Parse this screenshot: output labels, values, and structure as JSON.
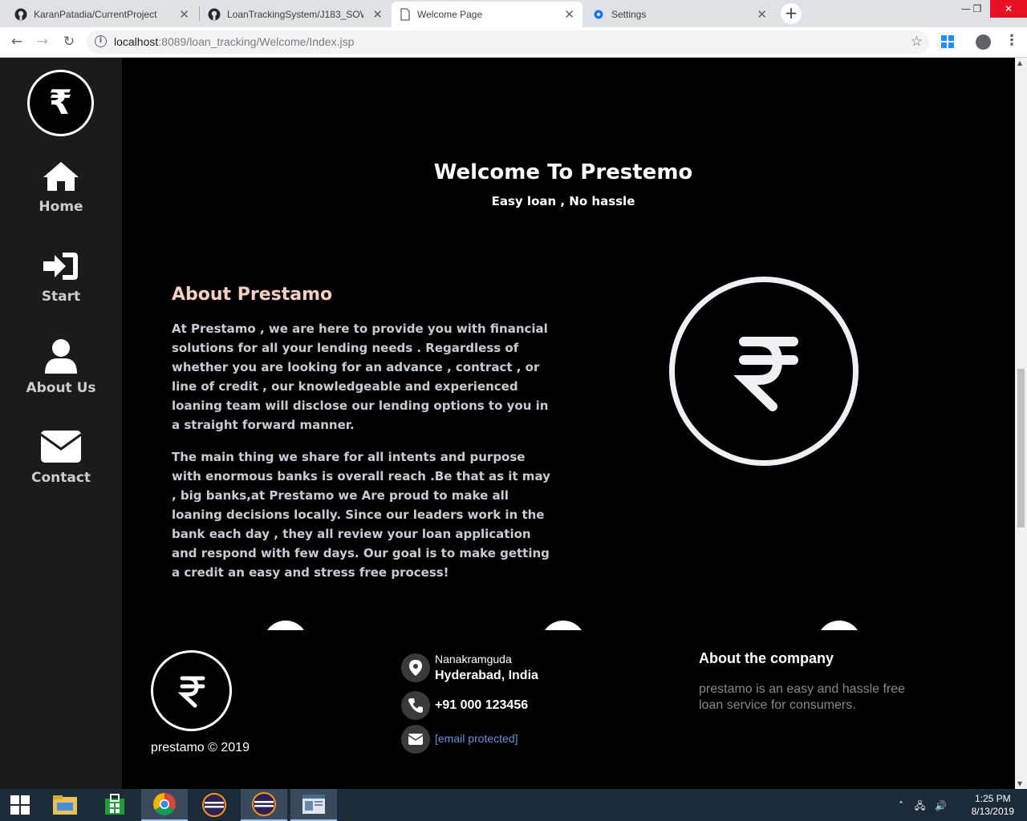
{
  "browser": {
    "tabs": [
      {
        "title": "KaranPatadia/CurrentProject",
        "icon": "github-icon",
        "active": false
      },
      {
        "title": "LoanTrackingSystem/J183_SOW",
        "icon": "github-icon",
        "active": false
      },
      {
        "title": "Welcome Page",
        "icon": "document-icon",
        "active": true
      },
      {
        "title": "Settings",
        "icon": "gear-icon",
        "active": false
      }
    ],
    "new_tab": "+",
    "url_host": "localhost",
    "url_path": ":8089/loan_tracking/Welcome/Index.jsp"
  },
  "sidebar": {
    "logo_symbol": "₹",
    "items": [
      {
        "label": "Home",
        "icon": "home-icon"
      },
      {
        "label": "Start",
        "icon": "sign-in-icon"
      },
      {
        "label": "About Us",
        "icon": "user-icon"
      },
      {
        "label": "Contact",
        "icon": "envelope-icon"
      }
    ]
  },
  "hero": {
    "title": "Welcome To Prestemo",
    "tagline": "Easy loan , No hassle"
  },
  "about": {
    "heading": "About Prestamo",
    "paragraph1": "At Prestamo , we are here to provide you with financial solutions for all your lending needs . Regardless of whether you are looking for an advance , contract , or line of credit , our knowledgeable and experienced loaning team will disclose our lending options to you in a straight forward manner.",
    "paragraph2": "The main thing we share for all intents and purpose with enormous banks is overall reach .Be that as it may , big banks,at Prestamo we Are proud to make all loaning decisions locally. Since our leaders work in the bank each day , they all review your loan application and respond with few days. Our goal is to make getting a credit an easy and stress free process!"
  },
  "footer": {
    "copyright": "prestamo © 2019",
    "address_line1": "Nanakramguda",
    "address_line2": "Hyderabad, India",
    "phone": "+91 000 123456",
    "email": "[email protected]",
    "about_heading": "About the company",
    "about_text": "prestamo is an easy and hassle free loan service for consumers."
  },
  "taskbar": {
    "time": "1:25 PM",
    "date": "8/13/2019"
  },
  "colors": {
    "sidebar_bg": "#1b1b1b",
    "about_heading": "#f5d0c0",
    "body_text": "#c7cbd6",
    "email_link": "#6f8fd8"
  }
}
